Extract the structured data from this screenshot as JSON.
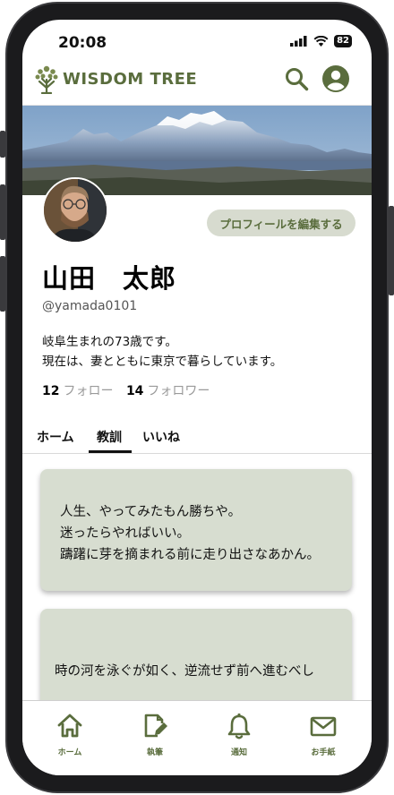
{
  "status_bar": {
    "time": "20:08",
    "battery": "82"
  },
  "app": {
    "title": "WISDOM TREE"
  },
  "profile": {
    "edit_button": "プロフィールを編集する",
    "name": "山田　太郎",
    "handle": "@yamada0101",
    "bio_line1": "岐阜生まれの73歳です。",
    "bio_line2": "現在は、妻とともに東京で暮らしています。",
    "following_count": "12",
    "following_label": "フォロー",
    "followers_count": "14",
    "followers_label": "フォロワー"
  },
  "tabs": [
    {
      "label": "ホーム"
    },
    {
      "label": "教訓",
      "active": true
    },
    {
      "label": "いいね"
    }
  ],
  "posts": [
    {
      "text": "人生、やってみたもん勝ちや。\n迷ったらやればいい。\n躊躇に芽を摘まれる前に走り出さなあかん。"
    },
    {
      "text": "時の河を泳ぐが如く、逆流せず前へ進むべし"
    }
  ],
  "bottom_nav": [
    {
      "label": "ホーム",
      "icon": "home-icon"
    },
    {
      "label": "執筆",
      "icon": "write-icon"
    },
    {
      "label": "通知",
      "icon": "bell-icon"
    },
    {
      "label": "お手紙",
      "icon": "mail-icon"
    }
  ],
  "colors": {
    "accent": "#5a6d3d",
    "card_bg": "#d7ddd0",
    "button_bg": "#d7dbcf"
  }
}
